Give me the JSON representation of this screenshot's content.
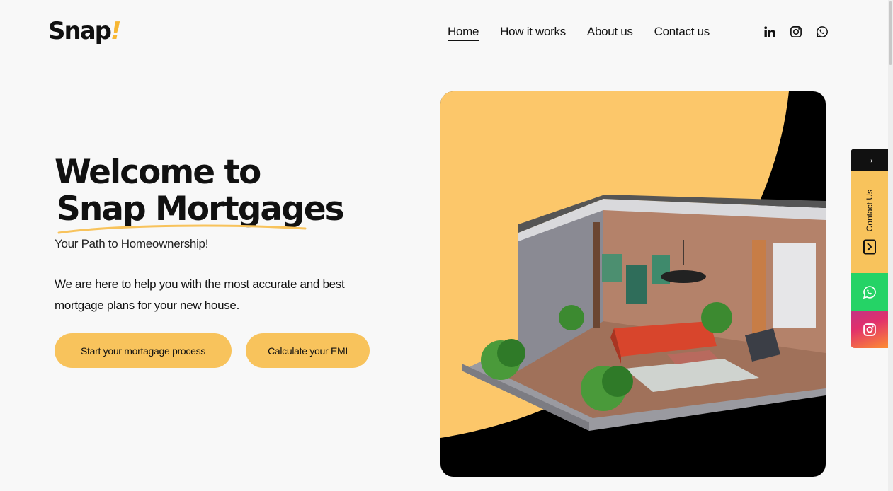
{
  "brand": {
    "name": "Snap",
    "mark": "!",
    "accent": "#f8c35c"
  },
  "nav": {
    "items": [
      {
        "label": "Home",
        "active": true
      },
      {
        "label": "How it works",
        "active": false
      },
      {
        "label": "About us",
        "active": false
      },
      {
        "label": "Contact us",
        "active": false
      }
    ]
  },
  "social": [
    "linkedin-icon",
    "instagram-icon",
    "whatsapp-icon"
  ],
  "hero": {
    "title_line1": "Welcome to",
    "title_line2": "Snap Mortgages",
    "tagline": "Your Path to Homeownership!",
    "description": "We are here to help you with the most accurate and best mortgage plans for your new house.",
    "primary_button": "Start your mortagage process",
    "secondary_button": "Calculate your EMI"
  },
  "side_panel": {
    "toggle": "→",
    "contact_label": "Contact Us",
    "colors": {
      "contact": "#f8c35c",
      "whatsapp": "#25d366"
    }
  }
}
